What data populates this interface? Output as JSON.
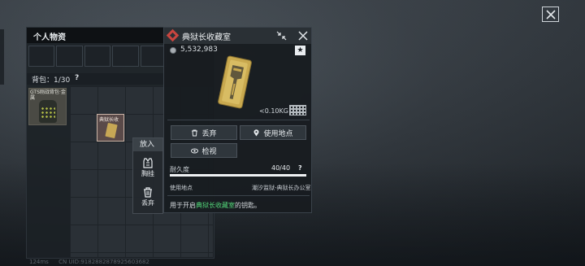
{
  "window": {
    "close_icon": "close-icon"
  },
  "inventory": {
    "title": "个人物资",
    "bag_label": "背包：1/30",
    "bag_help": "?",
    "items": [
      {
        "label": "GTS刚战背包·金属",
        "icon": "backpack-icon"
      },
      {
        "label": "典狱长收",
        "icon": "keycard-icon"
      }
    ]
  },
  "context_menu": {
    "title": "放入",
    "actions": [
      {
        "label": "胸挂",
        "icon": "vest-icon"
      },
      {
        "label": "丢弃",
        "icon": "trash-icon"
      }
    ]
  },
  "detail": {
    "title": "典狱长收藏室",
    "price": "5,532,983",
    "weight": "<0.10KG",
    "buttons": {
      "discard": "丢弃",
      "use_location": "使用地点",
      "inspect": "检视"
    },
    "durability_label": "耐久度",
    "durability_value": "40/40",
    "durability_fraction": 1.0,
    "durability_help": "?",
    "location_label": "使用地点",
    "location_value": "潮汐监狱-典狱长办公室",
    "description_prefix": "用于开启",
    "description_highlight": "典狱长收藏室",
    "description_suffix": "的钥匙。",
    "colors": {
      "accent": "#c9453f",
      "highlight": "#53d87a"
    }
  },
  "footer": {
    "ping": "124ms",
    "uid": "CN UID:9182882878925603682"
  }
}
